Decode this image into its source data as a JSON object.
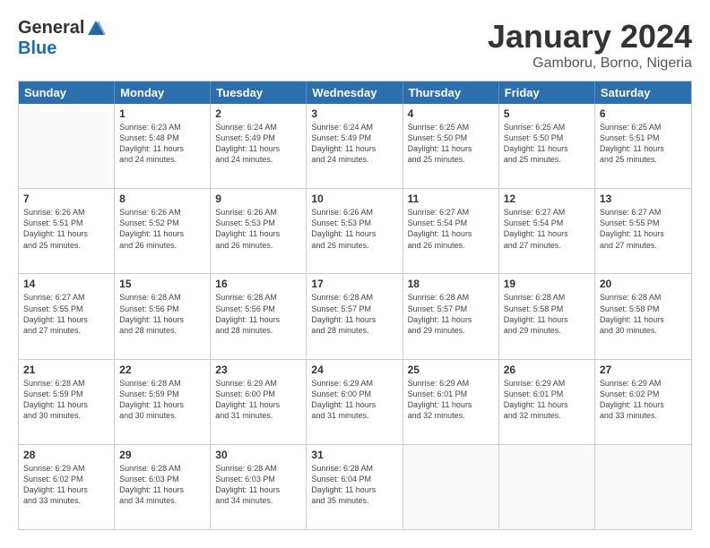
{
  "logo": {
    "general": "General",
    "blue": "Blue"
  },
  "title": "January 2024",
  "subtitle": "Gamboru, Borno, Nigeria",
  "header_days": [
    "Sunday",
    "Monday",
    "Tuesday",
    "Wednesday",
    "Thursday",
    "Friday",
    "Saturday"
  ],
  "weeks": [
    [
      {
        "day": "",
        "info": ""
      },
      {
        "day": "1",
        "info": "Sunrise: 6:23 AM\nSunset: 5:48 PM\nDaylight: 11 hours\nand 24 minutes."
      },
      {
        "day": "2",
        "info": "Sunrise: 6:24 AM\nSunset: 5:49 PM\nDaylight: 11 hours\nand 24 minutes."
      },
      {
        "day": "3",
        "info": "Sunrise: 6:24 AM\nSunset: 5:49 PM\nDaylight: 11 hours\nand 24 minutes."
      },
      {
        "day": "4",
        "info": "Sunrise: 6:25 AM\nSunset: 5:50 PM\nDaylight: 11 hours\nand 25 minutes."
      },
      {
        "day": "5",
        "info": "Sunrise: 6:25 AM\nSunset: 5:50 PM\nDaylight: 11 hours\nand 25 minutes."
      },
      {
        "day": "6",
        "info": "Sunrise: 6:25 AM\nSunset: 5:51 PM\nDaylight: 11 hours\nand 25 minutes."
      }
    ],
    [
      {
        "day": "7",
        "info": "Sunrise: 6:26 AM\nSunset: 5:51 PM\nDaylight: 11 hours\nand 25 minutes."
      },
      {
        "day": "8",
        "info": "Sunrise: 6:26 AM\nSunset: 5:52 PM\nDaylight: 11 hours\nand 26 minutes."
      },
      {
        "day": "9",
        "info": "Sunrise: 6:26 AM\nSunset: 5:53 PM\nDaylight: 11 hours\nand 26 minutes."
      },
      {
        "day": "10",
        "info": "Sunrise: 6:26 AM\nSunset: 5:53 PM\nDaylight: 11 hours\nand 26 minutes."
      },
      {
        "day": "11",
        "info": "Sunrise: 6:27 AM\nSunset: 5:54 PM\nDaylight: 11 hours\nand 26 minutes."
      },
      {
        "day": "12",
        "info": "Sunrise: 6:27 AM\nSunset: 5:54 PM\nDaylight: 11 hours\nand 27 minutes."
      },
      {
        "day": "13",
        "info": "Sunrise: 6:27 AM\nSunset: 5:55 PM\nDaylight: 11 hours\nand 27 minutes."
      }
    ],
    [
      {
        "day": "14",
        "info": "Sunrise: 6:27 AM\nSunset: 5:55 PM\nDaylight: 11 hours\nand 27 minutes."
      },
      {
        "day": "15",
        "info": "Sunrise: 6:28 AM\nSunset: 5:56 PM\nDaylight: 11 hours\nand 28 minutes."
      },
      {
        "day": "16",
        "info": "Sunrise: 6:28 AM\nSunset: 5:56 PM\nDaylight: 11 hours\nand 28 minutes."
      },
      {
        "day": "17",
        "info": "Sunrise: 6:28 AM\nSunset: 5:57 PM\nDaylight: 11 hours\nand 28 minutes."
      },
      {
        "day": "18",
        "info": "Sunrise: 6:28 AM\nSunset: 5:57 PM\nDaylight: 11 hours\nand 29 minutes."
      },
      {
        "day": "19",
        "info": "Sunrise: 6:28 AM\nSunset: 5:58 PM\nDaylight: 11 hours\nand 29 minutes."
      },
      {
        "day": "20",
        "info": "Sunrise: 6:28 AM\nSunset: 5:58 PM\nDaylight: 11 hours\nand 30 minutes."
      }
    ],
    [
      {
        "day": "21",
        "info": "Sunrise: 6:28 AM\nSunset: 5:59 PM\nDaylight: 11 hours\nand 30 minutes."
      },
      {
        "day": "22",
        "info": "Sunrise: 6:28 AM\nSunset: 5:59 PM\nDaylight: 11 hours\nand 30 minutes."
      },
      {
        "day": "23",
        "info": "Sunrise: 6:29 AM\nSunset: 6:00 PM\nDaylight: 11 hours\nand 31 minutes."
      },
      {
        "day": "24",
        "info": "Sunrise: 6:29 AM\nSunset: 6:00 PM\nDaylight: 11 hours\nand 31 minutes."
      },
      {
        "day": "25",
        "info": "Sunrise: 6:29 AM\nSunset: 6:01 PM\nDaylight: 11 hours\nand 32 minutes."
      },
      {
        "day": "26",
        "info": "Sunrise: 6:29 AM\nSunset: 6:01 PM\nDaylight: 11 hours\nand 32 minutes."
      },
      {
        "day": "27",
        "info": "Sunrise: 6:29 AM\nSunset: 6:02 PM\nDaylight: 11 hours\nand 33 minutes."
      }
    ],
    [
      {
        "day": "28",
        "info": "Sunrise: 6:29 AM\nSunset: 6:02 PM\nDaylight: 11 hours\nand 33 minutes."
      },
      {
        "day": "29",
        "info": "Sunrise: 6:28 AM\nSunset: 6:03 PM\nDaylight: 11 hours\nand 34 minutes."
      },
      {
        "day": "30",
        "info": "Sunrise: 6:28 AM\nSunset: 6:03 PM\nDaylight: 11 hours\nand 34 minutes."
      },
      {
        "day": "31",
        "info": "Sunrise: 6:28 AM\nSunset: 6:04 PM\nDaylight: 11 hours\nand 35 minutes."
      },
      {
        "day": "",
        "info": ""
      },
      {
        "day": "",
        "info": ""
      },
      {
        "day": "",
        "info": ""
      }
    ]
  ]
}
